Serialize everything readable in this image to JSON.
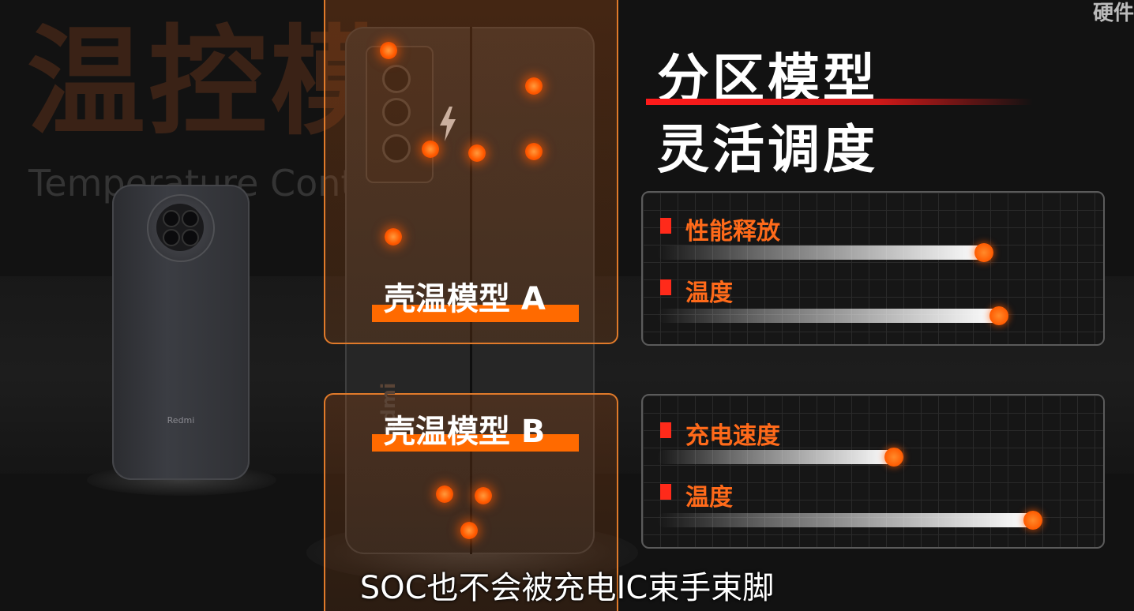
{
  "watermark": {
    "big_title": "温控模",
    "big_subtitle": "Temperature Contro",
    "corner": "硬件"
  },
  "left_phone": {
    "brand": "Redmi"
  },
  "center_phone": {
    "brand": "Redmi",
    "icon": "lightning-bolt-icon"
  },
  "zones": {
    "a": {
      "label": "壳温模型 A"
    },
    "b": {
      "label": "壳温模型 B"
    }
  },
  "titles": {
    "line1": "分区模型",
    "line2": "灵活调度"
  },
  "panels": [
    {
      "metrics": [
        {
          "label": "性能释放",
          "level": 0.87
        },
        {
          "label": "温度",
          "level": 0.91
        }
      ]
    },
    {
      "metrics": [
        {
          "label": "充电速度",
          "level": 0.63
        },
        {
          "label": "温度",
          "level": 1.0
        }
      ]
    }
  ],
  "subtitle": "SOC也不会被充电IC束手束脚",
  "colors": {
    "accent_orange": "#ff6a00",
    "title_red": "#ff1a1a",
    "metric_label": "#ff6a1a",
    "zone_border": "#e07a2a"
  }
}
